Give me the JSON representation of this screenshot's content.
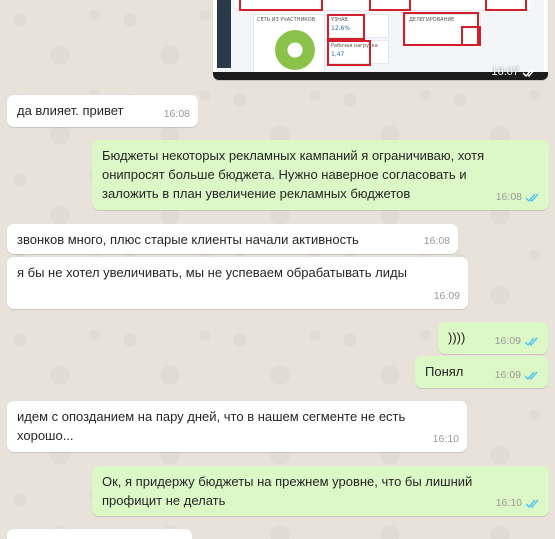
{
  "colors": {
    "incoming_bubble": "#ffffff",
    "outgoing_bubble": "#dcf8c6",
    "read_ticks": "#4fc3f7",
    "timestamp": "#9a9a9a"
  },
  "screenshot_image": {
    "time": "16:07",
    "status_icon": "double-check-icon",
    "labels": {
      "card1": "СЕТЬ ИЗ УЧАСТНИКОВ",
      "card2": "УЗНАВ",
      "card2_value": "12,6%",
      "card3": "ДЕЛЕГИРОВАНИЕ",
      "card4": "Рабочая нагрузка",
      "card4_value": "1,47"
    }
  },
  "messages": [
    {
      "direction": "in",
      "text": "да влияет. привет",
      "time": "16:08"
    },
    {
      "direction": "out",
      "text": "Бюджеты некоторых рекламных кампаний я ограничиваю, хотя\nонипросят больше бюджета. Нужно наверное согласовать и\nзаложить в план увеличение рекламных бюджетов",
      "time": "16:08",
      "read": true
    },
    {
      "direction": "in",
      "text": "звонков много, плюс старые клиенты начали активность",
      "time": "16:08"
    },
    {
      "direction": "in",
      "text": "я бы не хотел увеличивать, мы не успеваем обрабатывать лиды",
      "time": "16:09"
    },
    {
      "direction": "out",
      "text": "))))",
      "time": "16:09",
      "read": true
    },
    {
      "direction": "out",
      "text": "Понял",
      "time": "16:09",
      "read": true
    },
    {
      "direction": "in",
      "text": "идем с опозданием на пару дней, что в нашем сегменте не есть\nхорошо...",
      "time": "16:10"
    },
    {
      "direction": "out",
      "text": "Ок, я придержу бюджеты на прежнем уровне, что бы лишний\nпрофицит не делать",
      "time": "16:10",
      "read": true
    }
  ]
}
